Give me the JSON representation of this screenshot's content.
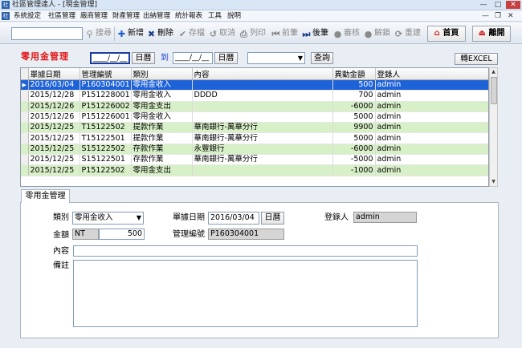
{
  "window": {
    "title": "社區管理達人 - [現金管理]",
    "min": "—",
    "max": "□",
    "close": "✕",
    "mdi_min": "—",
    "mdi_restore": "❐",
    "mdi_close": "✕"
  },
  "menu": [
    "系統設定",
    "社區管理",
    "廠商管理",
    "財產管理",
    "出納管理",
    "統計報表",
    "工具",
    "說明"
  ],
  "toolbar": {
    "search_label": "搜尋",
    "new": "新增",
    "delete": "刪除",
    "save": "存檔",
    "cancel": "取消",
    "print": "列印",
    "prev": "前筆",
    "next": "後筆",
    "review": "審核",
    "unreview": "解鎖",
    "reset": "重建",
    "home": "首頁",
    "exit": "離開"
  },
  "filter": {
    "title": "零用金管理",
    "date_from": "____/__/__",
    "date_btn": "日曆",
    "to": "到",
    "date_to": "____/__/__",
    "date_btn2": "日曆",
    "select_value": "",
    "query": "查詢",
    "excel": "轉EXCEL"
  },
  "grid": {
    "columns": [
      "單據日期",
      "管理編號",
      "類別",
      "內容",
      "異動金額",
      "登錄人"
    ],
    "rows": [
      [
        "2016/03/04",
        "P160304001",
        "零用金收入",
        "",
        "500",
        "admin"
      ],
      [
        "2015/12/28",
        "P151228001",
        "零用金收入",
        "DDDD",
        "700",
        "admin"
      ],
      [
        "2015/12/26",
        "P151226002",
        "零用金支出",
        "",
        "-6000",
        "admin"
      ],
      [
        "2015/12/26",
        "P151226001",
        "零用金收入",
        "",
        "5000",
        "admin"
      ],
      [
        "2015/12/25",
        "T15122502",
        "提款作業",
        "華南銀行-萬華分行",
        "9900",
        "admin"
      ],
      [
        "2015/12/25",
        "T15122501",
        "提款作業",
        "華南銀行-萬華分行",
        "5000",
        "admin"
      ],
      [
        "2015/12/25",
        "S15122502",
        "存款作業",
        "永豐銀行",
        "-6000",
        "admin"
      ],
      [
        "2015/12/25",
        "S15122501",
        "存款作業",
        "華南銀行-萬華分行",
        "-5000",
        "admin"
      ],
      [
        "2015/12/25",
        "P15122502",
        "零用金支出",
        "",
        "-1000",
        "admin"
      ]
    ]
  },
  "detail": {
    "tab": "零用金管理",
    "type_label": "類別",
    "type_value": "零用金收入",
    "date_label": "單據日期",
    "date_value": "2016/03/04",
    "calendar": "日曆",
    "user_label": "登錄人",
    "user_value": "admin",
    "amount_label": "金額",
    "currency": "NT",
    "amount_value": "500",
    "code_label": "管理編號",
    "code_value": "P160304001",
    "content_label": "內容",
    "content_value": "",
    "memo_label": "備註",
    "memo_value": ""
  },
  "colors": {
    "accent": "#e01818",
    "selection": "#1e62d8",
    "alt_row": "#d8f0c8"
  }
}
